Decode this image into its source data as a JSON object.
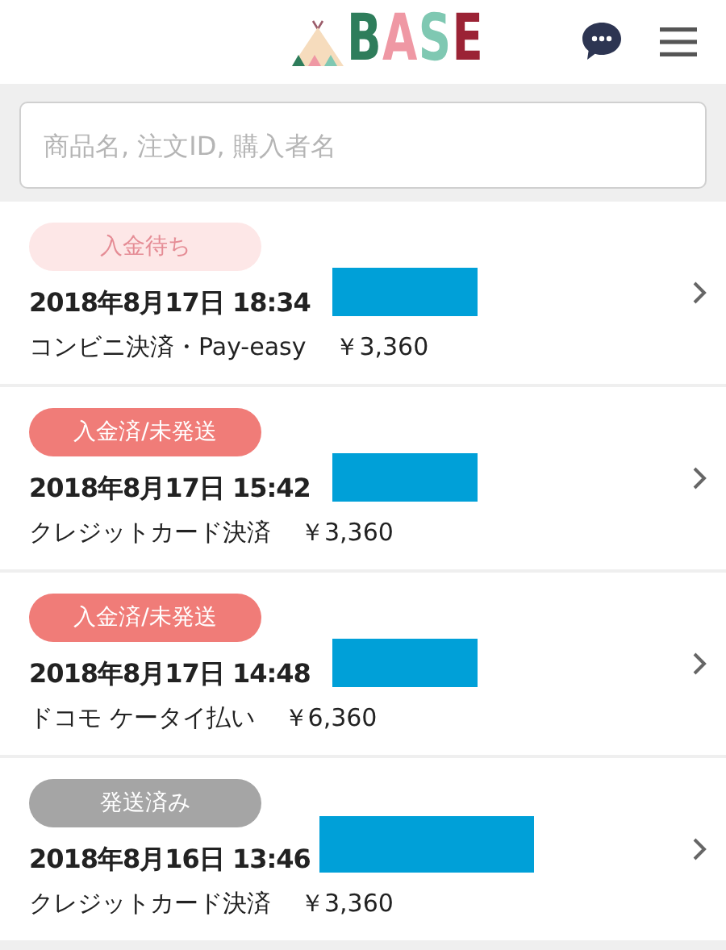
{
  "header": {
    "logo": "BASE"
  },
  "search": {
    "placeholder": "商品名, 注文ID, 購入者名"
  },
  "orders": [
    {
      "status": "入金待ち",
      "kind": "pending",
      "datetime": "2018年8月17日 18:34",
      "redacted": true,
      "payment": "コンビニ決済・Pay-easy",
      "amount": "￥3,360"
    },
    {
      "status": "入金済/未発送",
      "kind": "paid",
      "datetime": "2018年8月17日 15:42",
      "redacted": true,
      "payment": "クレジットカード決済",
      "amount": "￥3,360"
    },
    {
      "status": "入金済/未発送",
      "kind": "paid",
      "datetime": "2018年8月17日 14:48",
      "redacted": true,
      "payment": "ドコモ ケータイ払い",
      "amount": "￥6,360"
    },
    {
      "status": "発送済み",
      "kind": "shipped",
      "datetime": "2018年8月16日 13:46",
      "redacted": true,
      "payment": "クレジットカード決済",
      "amount": "￥3,360"
    }
  ]
}
